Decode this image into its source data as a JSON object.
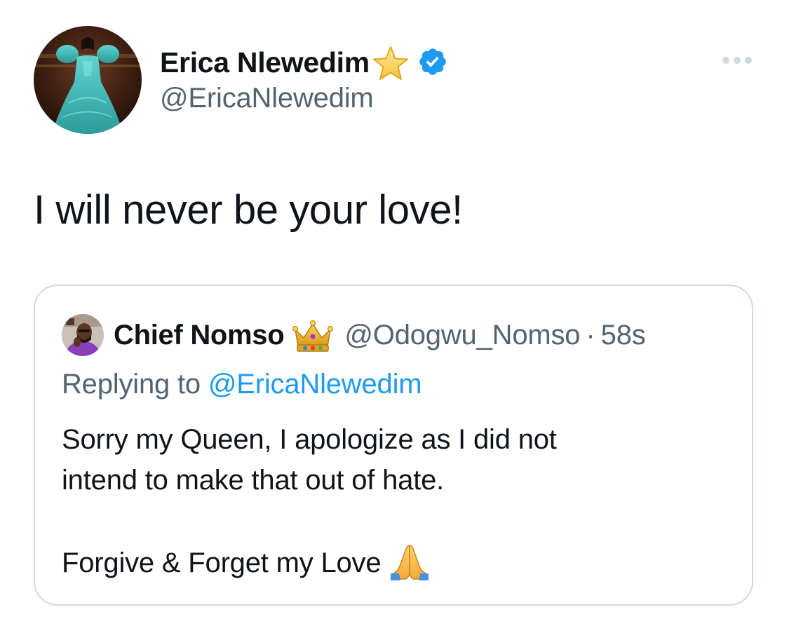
{
  "author": {
    "name": "Erica Nlewedim",
    "handle": "@EricaNlewedim",
    "name_emoji": "star-emoji",
    "verified": true,
    "verified_color": "#1d9bf0"
  },
  "tweet": {
    "text": "I will never be your love!"
  },
  "quoted": {
    "name": "Chief Nomso",
    "name_emoji": "crown-emoji",
    "handle": "@Odogwu_Nomso",
    "separator": "·",
    "time": "58s",
    "replying_prefix": "Replying to ",
    "replying_to": "@EricaNlewedim",
    "body_line_1": "Sorry my Queen, I apologize as I did not",
    "body_line_2": "intend to make that out of hate.",
    "body_line_3": "Forgive & Forget my Love",
    "body_emoji": "folded-hands-emoji"
  },
  "colors": {
    "text_primary": "#0f1419",
    "text_secondary": "#536471",
    "link": "#1d9bf0",
    "border": "#cfd9de"
  }
}
